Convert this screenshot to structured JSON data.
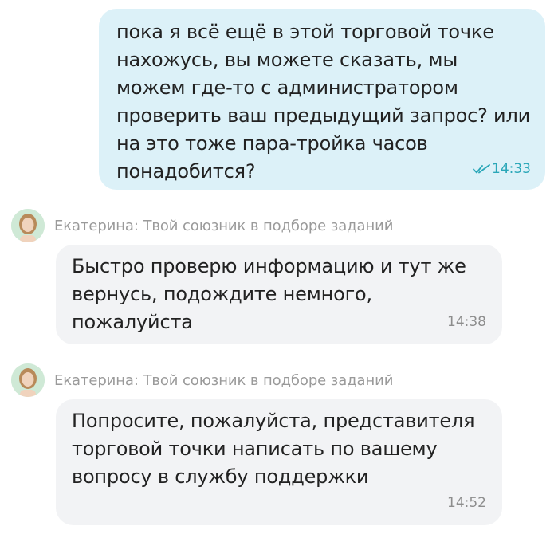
{
  "messages": [
    {
      "direction": "outgoing",
      "text": "пока я всё ещё в этой торговой точке нахожусь, вы можете сказать, мы можем где-то с администратором проверить ваш предыдущий запрос? или на это тоже пара-тройка часов понадобится?",
      "time": "14:33",
      "status_icon": "double-check-icon"
    },
    {
      "direction": "incoming",
      "sender": "Екатерина: Твой союзник в подборе заданий",
      "text": "Быстро проверю информацию и тут же вернусь, подождите немного, пожалуйста",
      "time": "14:38"
    },
    {
      "direction": "incoming",
      "sender": "Екатерина: Твой союзник в подборе заданий",
      "text": "Попросите, пожалуйста, представителя торговой точки написать по вашему вопросу в службу поддержки",
      "time": "14:52"
    }
  ],
  "colors": {
    "outgoing_bubble": "#dcf1f8",
    "incoming_bubble": "#f2f3f5",
    "read_status": "#2aa7b8"
  }
}
